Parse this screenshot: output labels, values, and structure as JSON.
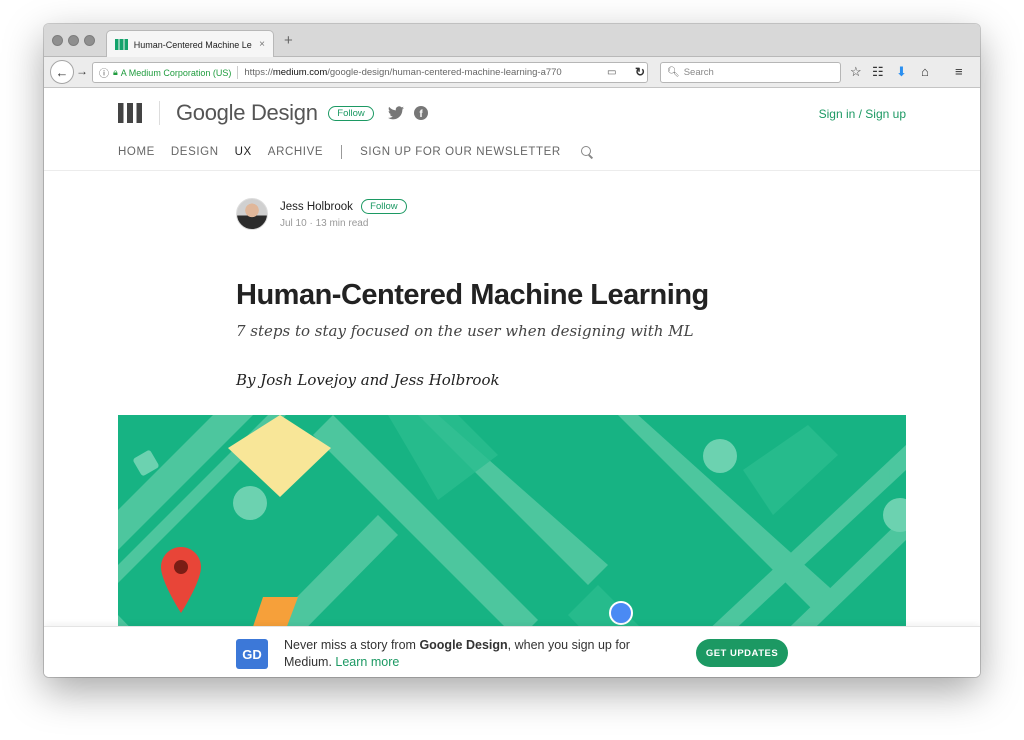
{
  "browser": {
    "tab_title": "Human-Centered Machine Le",
    "tab_close": "×",
    "new_tab": "+",
    "url_org": "A Medium Corporation (US)",
    "url_prefix": "https://",
    "url_domain": "medium.com",
    "url_path": "/google-design/human-centered-machine-learning-a770",
    "search_placeholder": "Search",
    "icons": [
      "back-arrow-icon",
      "forward-arrow-icon",
      "info-icon",
      "lock-icon",
      "reader-view-icon",
      "reload-icon",
      "search-icon",
      "bookmark-star-icon",
      "library-icon",
      "download-icon",
      "home-icon",
      "menu-icon"
    ]
  },
  "header": {
    "publication": "Google Design",
    "follow_label": "Follow",
    "signin_label": "Sign in / Sign up",
    "nav": [
      {
        "label": "HOME",
        "active": false
      },
      {
        "label": "DESIGN",
        "active": false
      },
      {
        "label": "UX",
        "active": true
      },
      {
        "label": "ARCHIVE",
        "active": false
      }
    ],
    "newsletter_label": "SIGN UP FOR OUR NEWSLETTER"
  },
  "article": {
    "author": "Jess Holbrook",
    "author_follow": "Follow",
    "date": "Jul 10",
    "read_time": "13 min read",
    "title": "Human-Centered Machine Learning",
    "subtitle": "7 steps to stay focused on the user when designing with ML",
    "byline": "By Josh Lovejoy and Jess Holbrook"
  },
  "banner": {
    "badge": "GD",
    "text_before": "Never miss a story from ",
    "text_bold": "Google Design",
    "text_after": ", when you sign up for Medium. ",
    "learn_more": "Learn more",
    "cta": "GET UPDATES"
  },
  "colors": {
    "accent_green": "#1c9963",
    "hero_green": "#17b383",
    "badge_blue": "#3c78d8"
  }
}
